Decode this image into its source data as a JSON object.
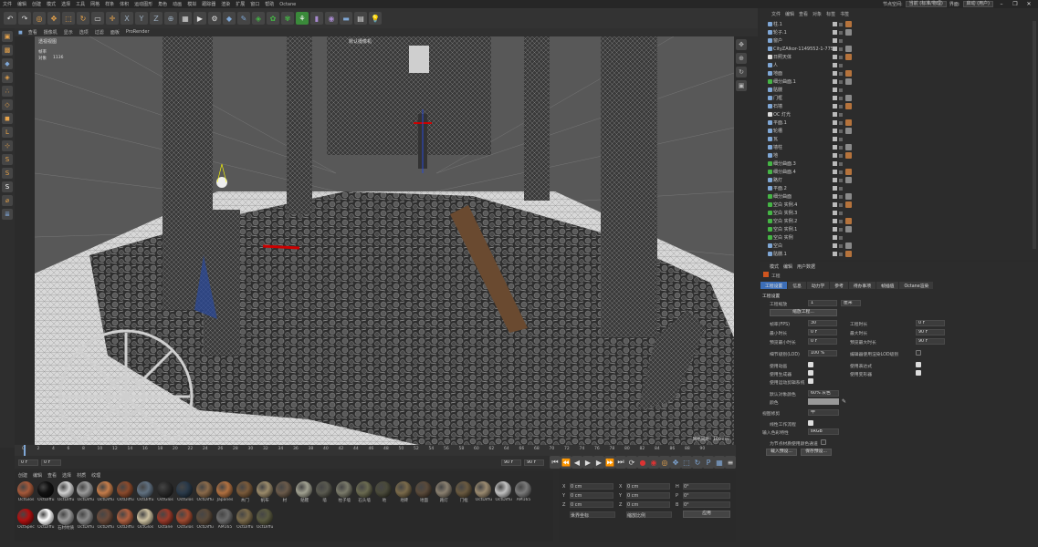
{
  "menubar": {
    "items": [
      "文件",
      "编辑",
      "创建",
      "模式",
      "选择",
      "工具",
      "网格",
      "样条",
      "体积",
      "运动图形",
      "角色",
      "动画",
      "模拟",
      "跟踪器",
      "渲染",
      "扩展",
      "窗口",
      "帮助",
      "Octane"
    ],
    "node_space_label": "节点空间:",
    "node_space_value": "当前 (标准/物理)",
    "layout_label": "界面:",
    "layout_value": "启动 (用户)"
  },
  "viewport": {
    "menu": [
      "查看",
      "摄像机",
      "显示",
      "选项",
      "过滤",
      "面板",
      "ProRender"
    ],
    "view_label": "透视视图",
    "cam_label": "默认摄像机",
    "hud_fps_label": "帧率",
    "hud_obj_label": "对象",
    "hud_obj_value": "1136",
    "grid_spacing": "网格间距 : 100 cm"
  },
  "timeline": {
    "ticks": [
      "0",
      "2",
      "4",
      "6",
      "8",
      "10",
      "12",
      "14",
      "16",
      "18",
      "20",
      "22",
      "24",
      "26",
      "28",
      "30",
      "32",
      "34",
      "36",
      "38",
      "40",
      "42",
      "44",
      "46",
      "48",
      "50",
      "52",
      "54",
      "56",
      "58",
      "60",
      "62",
      "64",
      "66",
      "68",
      "70",
      "72",
      "74",
      "76",
      "78",
      "80",
      "82",
      "84",
      "86",
      "88",
      "90"
    ],
    "start_field": "0 F",
    "current_field": "0 F",
    "end_field": "90 F",
    "end_field2": "90 F",
    "frame_label": "0 F"
  },
  "materials": {
    "menu": [
      "创建",
      "编辑",
      "查看",
      "选择",
      "材质",
      "纹理"
    ],
    "items": [
      {
        "label": "OctGlos",
        "color": "#a5593a"
      },
      {
        "label": "OctDiffu",
        "color": "#111111"
      },
      {
        "label": "OctDiffu",
        "color": "#d0d0d0"
      },
      {
        "label": "OctDiffu",
        "color": "#9a9a9a"
      },
      {
        "label": "OctDiffu",
        "color": "#c47c4a"
      },
      {
        "label": "OctDiffu",
        "color": "#8a4a2c"
      },
      {
        "label": "OctDiffu",
        "color": "#607080"
      },
      {
        "label": "OctGlos",
        "color": "#2a2a2a"
      },
      {
        "label": "OctGlos",
        "color": "#2a3a4a"
      },
      {
        "label": "OctDiffu",
        "color": "#8a6a4a"
      },
      {
        "label": "Japanes",
        "color": "#b07040"
      },
      {
        "label": "木门",
        "color": "#7a5a3a"
      },
      {
        "label": "帆布",
        "color": "#9a8a6a"
      },
      {
        "label": "材",
        "color": "#6a5a4a"
      },
      {
        "label": "骷髅",
        "color": "#a0a090"
      },
      {
        "label": "墙",
        "color": "#5a5a50"
      },
      {
        "label": "柱子墙",
        "color": "#7a7a6a"
      },
      {
        "label": "石头墙",
        "color": "#6a6a50"
      },
      {
        "label": "地",
        "color": "#4a4a3a"
      },
      {
        "label": "地砖",
        "color": "#7a6a4a"
      },
      {
        "label": "地面",
        "color": "#5a4a3a"
      },
      {
        "label": "路灯",
        "color": "#8a8070"
      },
      {
        "label": "门框",
        "color": "#6a5a40"
      },
      {
        "label": "OctDiffu",
        "color": "#9a8a70"
      },
      {
        "label": "OctDiffu",
        "color": "#c0c0c0"
      },
      {
        "label": "AM165",
        "color": "#7a7a7a"
      },
      {
        "label": "OctSpec",
        "color": "#b01010"
      },
      {
        "label": "OctDiffu",
        "color": "#ffffff"
      },
      {
        "label": "石材材质",
        "color": "#9a9a9a"
      },
      {
        "label": "OctDiffu",
        "color": "#8a8a8a"
      },
      {
        "label": "OctDiffu",
        "color": "#6a4a3a"
      },
      {
        "label": "OctDiffu",
        "color": "#b06040"
      },
      {
        "label": "OctGlos",
        "color": "#ccc0a0"
      },
      {
        "label": "Octane",
        "color": "#9a3a2a"
      },
      {
        "label": "OctGlos",
        "color": "#a04a30"
      },
      {
        "label": "OctDiffu",
        "color": "#5a4a3a"
      },
      {
        "label": "AM165",
        "color": "#6a6a6a"
      },
      {
        "label": "OctDiffu",
        "color": "#7a6a4a"
      },
      {
        "label": "OctDiffu",
        "color": "#5a5a40"
      }
    ]
  },
  "coords": {
    "x": "X",
    "y": "Y",
    "z": "Z",
    "x_val": "0 cm",
    "y_val": "0 cm",
    "z_val": "0 cm",
    "x2_val": "0 cm",
    "y2_val": "0 cm",
    "z2_val": "0 cm",
    "h": "H",
    "p": "P",
    "b": "B",
    "h_val": "0°",
    "p_val": "0°",
    "b_val": "0°",
    "mode1": "世界坐标",
    "mode2": "缩放比例",
    "apply": "应用"
  },
  "objmgr": {
    "tabs": [
      "文件",
      "编辑",
      "查看",
      "对象",
      "标签",
      "书签"
    ],
    "rows": [
      {
        "name": "柱.1",
        "color": "#7fa7d6"
      },
      {
        "name": "轮子.1",
        "color": "#7fa7d6"
      },
      {
        "name": "窗户",
        "color": "#7fa7d6"
      },
      {
        "name": "CityZAlkor-1149552-1-775",
        "color": "#7fa7d6"
      },
      {
        "name": "日照天体",
        "color": "#dddddd"
      },
      {
        "name": "人",
        "color": "#7fa7d6"
      },
      {
        "name": "地面",
        "color": "#7fa7d6"
      },
      {
        "name": "细分曲面.1",
        "color": "#45b545"
      },
      {
        "name": "骷髅",
        "color": "#7fa7d6"
      },
      {
        "name": "门框",
        "color": "#7fa7d6"
      },
      {
        "name": "石墙",
        "color": "#7fa7d6"
      },
      {
        "name": "OC 灯光",
        "color": "#dddddd"
      },
      {
        "name": "平面.1",
        "color": "#7fa7d6"
      },
      {
        "name": "轮槽",
        "color": "#7fa7d6"
      },
      {
        "name": "瓦",
        "color": "#7fa7d6"
      },
      {
        "name": "墙柱",
        "color": "#7fa7d6"
      },
      {
        "name": "地",
        "color": "#7fa7d6"
      },
      {
        "name": "细分曲面.3",
        "color": "#45b545"
      },
      {
        "name": "细分曲面.4",
        "color": "#45b545"
      },
      {
        "name": "路灯",
        "color": "#7fa7d6"
      },
      {
        "name": "平面.2",
        "color": "#7fa7d6"
      },
      {
        "name": "细分曲面",
        "color": "#45b545"
      },
      {
        "name": "空白 实例.4",
        "color": "#45b545"
      },
      {
        "name": "空白 实例.3",
        "color": "#45b545"
      },
      {
        "name": "空白 实例.2",
        "color": "#45b545"
      },
      {
        "name": "空白 实例.1",
        "color": "#45b545"
      },
      {
        "name": "空白 实例",
        "color": "#45b545"
      },
      {
        "name": "空白",
        "color": "#7fa7d6"
      },
      {
        "name": "骷髅.1",
        "color": "#7fa7d6"
      }
    ]
  },
  "attrmgr": {
    "menu": [
      "模式",
      "编辑",
      "用户数据"
    ],
    "title": "工程",
    "tabs": [
      "工程设置",
      "信息",
      "动力学",
      "参考",
      "待办事项",
      "帧插值",
      "Octane渲染"
    ],
    "section": "工程设置",
    "scale_label": "工程缩放",
    "scale_value": "1",
    "scale_unit": "厘米",
    "scale_button": "缩放工程...",
    "fps_label": "帧率(FPS)",
    "fps_value": "30",
    "proj_time_label": "工程时长",
    "proj_time_value": "0 F",
    "min_time_label": "最小时长",
    "min_time_value": "0 F",
    "max_time_label": "最大时长",
    "max_time_value": "90 F",
    "prev_min_label": "预览最小时长",
    "prev_min_value": "0 F",
    "prev_max_label": "预览最大时长",
    "prev_max_value": "90 F",
    "lod_label": "细节级别(LOD)",
    "lod_value": "100 %",
    "lod_render_label": "编辑器使用渲染LOD级别",
    "anim_label": "使用动画",
    "expr_label": "使用表达式",
    "gen_label": "使用生成器",
    "deform_label": "使用变形器",
    "motion_label": "使用运动剪辑系统",
    "color_label": "默认对象颜色",
    "color_value": "60% 灰色",
    "color2_label": "颜色",
    "view_clip_label": "视图修剪",
    "view_clip_value": "中",
    "linear_label": "线性工作流程",
    "input_color_label": "输入色彩特性",
    "input_color_value": "sRGB",
    "node_label": "为节点材质使用颜色通道",
    "load_button": "载入预设...",
    "save_button": "保存预设..."
  }
}
